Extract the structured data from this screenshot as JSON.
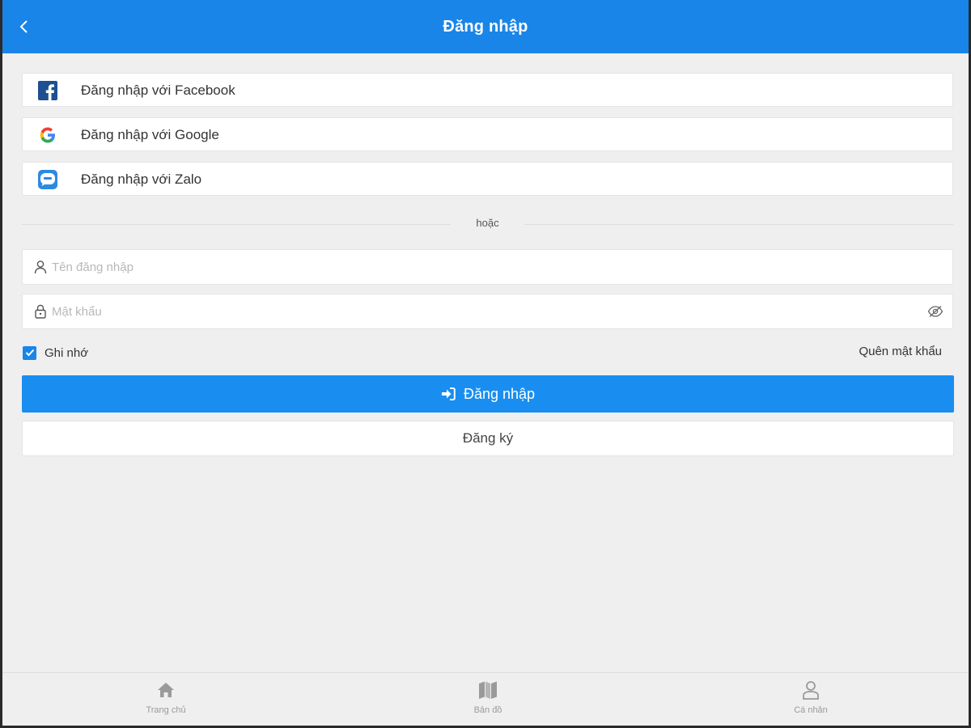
{
  "header": {
    "title": "Đăng nhập",
    "back_icon": "chevron-left-icon"
  },
  "social": [
    {
      "label": "Đăng nhập với Facebook",
      "icon": "facebook-icon"
    },
    {
      "label": "Đăng nhập với Google",
      "icon": "google-icon"
    },
    {
      "label": "Đăng nhập với Zalo",
      "icon": "zalo-icon"
    }
  ],
  "divider": {
    "text": "hoặc"
  },
  "form": {
    "username": {
      "placeholder": "Tên đăng nhập",
      "value": "",
      "icon": "user-icon"
    },
    "password": {
      "placeholder": "Mật khẩu",
      "value": "",
      "icon": "lock-icon",
      "toggle_icon": "eye-off-icon"
    },
    "remember": {
      "label": "Ghi nhớ",
      "checked": true
    },
    "forgot_label": "Quên mật khẩu",
    "login_label": "Đăng nhập",
    "login_icon": "sign-in-icon",
    "register_label": "Đăng ký"
  },
  "bottom_nav": [
    {
      "label": "Trang chủ",
      "icon": "home-icon"
    },
    {
      "label": "Bản đồ",
      "icon": "map-icon"
    },
    {
      "label": "Cá nhân",
      "icon": "user-icon"
    }
  ],
  "colors": {
    "primary": "#1a85e8",
    "button": "#1a8ef0",
    "background": "#efefef",
    "facebook": "#1d4f91",
    "zalo": "#2d8ae0"
  }
}
